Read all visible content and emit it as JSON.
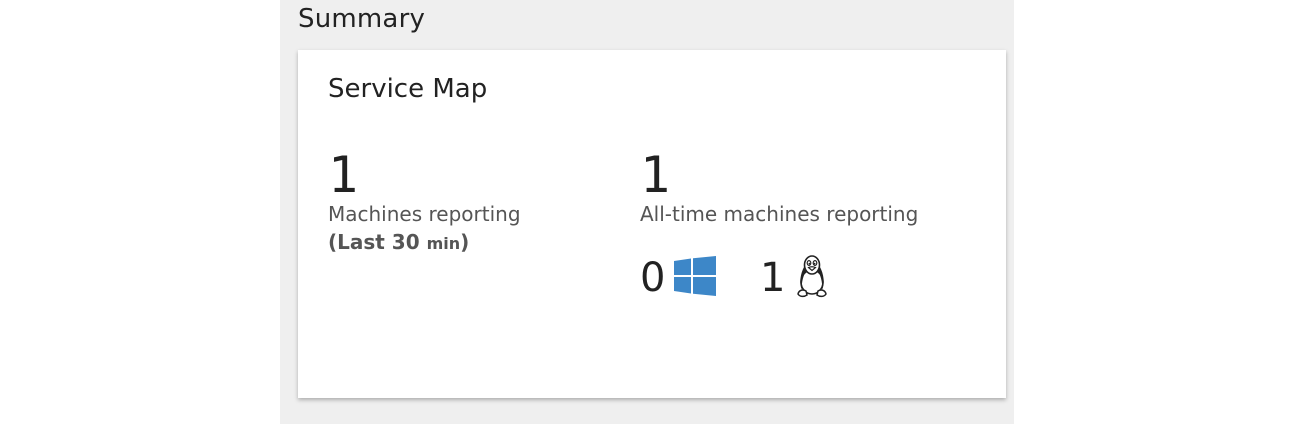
{
  "summary": {
    "title": "Summary"
  },
  "tile": {
    "title": "Service Map",
    "machines_reporting": {
      "value": "1",
      "label": "Machines reporting",
      "period_prefix": "(Last 30 ",
      "period_unit": "min",
      "period_suffix": ")"
    },
    "all_time": {
      "value": "1",
      "label": "All-time machines reporting",
      "windows_count": "0",
      "linux_count": "1"
    }
  },
  "icons": {
    "windows": "windows-logo-icon",
    "linux": "linux-penguin-icon"
  },
  "colors": {
    "panel_background": "#efefef",
    "windows_blue": "#3d87c8"
  }
}
